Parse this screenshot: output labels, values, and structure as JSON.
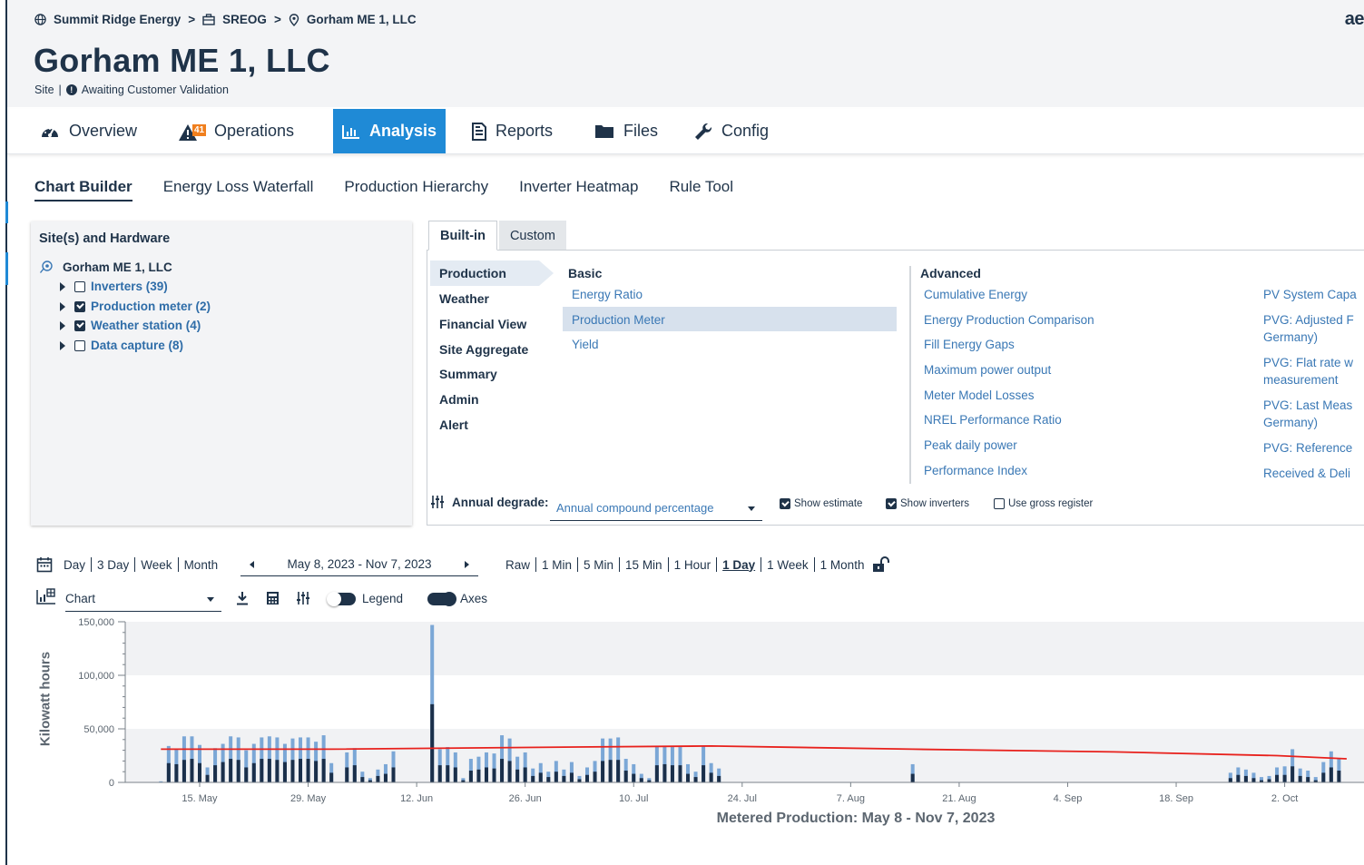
{
  "breadcrumb": {
    "items": [
      {
        "label": "Summit Ridge Energy",
        "icon": "globe-icon"
      },
      {
        "label": "SREOG",
        "icon": "briefcase-icon"
      },
      {
        "label": "Gorham ME 1, LLC",
        "icon": "location-pin-icon"
      }
    ],
    "separator": ">"
  },
  "brand": "ae",
  "site": {
    "title": "Gorham ME 1, LLC",
    "type": "Site",
    "status": "Awaiting Customer Validation"
  },
  "nav": {
    "tabs": [
      {
        "label": "Overview",
        "icon": "gauge-icon"
      },
      {
        "label": "Operations",
        "icon": "alert-triangle-icon",
        "badge": "41"
      },
      {
        "label": "Analysis",
        "icon": "chart-icon",
        "active": true
      },
      {
        "label": "Reports",
        "icon": "report-icon"
      },
      {
        "label": "Files",
        "icon": "folder-icon"
      },
      {
        "label": "Config",
        "icon": "wrench-icon"
      }
    ]
  },
  "subtabs": [
    "Chart Builder",
    "Energy Loss Waterfall",
    "Production Hierarchy",
    "Inverter Heatmap",
    "Rule Tool"
  ],
  "hardware": {
    "heading": "Site(s) and Hardware",
    "root": "Gorham ME 1, LLC",
    "items": [
      {
        "label": "Inverters (39)",
        "checked": false
      },
      {
        "label": "Production meter (2)",
        "checked": true
      },
      {
        "label": "Weather station (4)",
        "checked": true
      },
      {
        "label": "Data capture (8)",
        "checked": false
      }
    ]
  },
  "builder": {
    "tabs": [
      "Built-in",
      "Custom"
    ],
    "categories": [
      "Production",
      "Weather",
      "Financial View",
      "Site Aggregate",
      "Summary",
      "Admin",
      "Alert"
    ],
    "basic_heading": "Basic",
    "basic": [
      "Energy Ratio",
      "Production Meter",
      "Yield"
    ],
    "advanced_heading": "Advanced",
    "advanced": [
      "Cumulative Energy",
      "Energy Production Comparison",
      "Fill Energy Gaps",
      "Maximum power output",
      "Meter Model Losses",
      "NREL Performance Ratio",
      "Peak daily power",
      "Performance Index"
    ],
    "advanced2": [
      "PV System Capa",
      "PVG: Adjusted F",
      "Germany)",
      "PVG: Flat rate w",
      "measurement",
      "PVG: Last Meas",
      "Germany)",
      "PVG: Reference",
      "Received & Deli"
    ],
    "degrade_label": "Annual degrade:",
    "degrade_value": "Annual compound percentage",
    "show_estimate": "Show estimate",
    "show_inverters": "Show inverters",
    "use_gross": "Use gross register"
  },
  "toolbar": {
    "ranges": [
      "Day",
      "3 Day",
      "Week",
      "Month"
    ],
    "date_range": "May 8, 2023 - Nov 7, 2023",
    "resolutions": [
      "Raw",
      "1 Min",
      "5 Min",
      "15 Min",
      "1 Hour",
      "1 Day",
      "1 Week",
      "1 Month"
    ],
    "active_resolution": "1 Day",
    "chart_type": "Chart",
    "legend_label": "Legend",
    "legend_on": false,
    "axes_label": "Axes",
    "axes_on": true
  },
  "colors": {
    "accent": "#1f8ad6",
    "navy": "#1f3349",
    "badge": "#f07f1e",
    "bar_light": "#7ba7d6",
    "bar_dark": "#1a2f4a",
    "estimate_line": "#e8211c"
  },
  "chart_data": {
    "type": "bar",
    "title": "Metered Production: May 8 - Nov 7, 2023",
    "ylabel": "Kilowatt hours",
    "yticks": [
      "0",
      "50,000",
      "100,000",
      "150,000"
    ],
    "ylim": [
      0,
      150000
    ],
    "xticks": [
      "15. May",
      "29. May",
      "12. Jun",
      "26. Jun",
      "10. Jul",
      "24. Jul",
      "7. Aug",
      "21. Aug",
      "4. Sep",
      "18. Sep",
      "2. Oct"
    ],
    "series": [
      {
        "name": "meter-light",
        "color": "#7ba7d6"
      },
      {
        "name": "meter-dark",
        "color": "#1a2f4a"
      },
      {
        "name": "estimate",
        "color": "#e8211c"
      }
    ],
    "bars": [
      {
        "date": "2023-05-10",
        "total": 1000,
        "dark": 400
      },
      {
        "date": "2023-05-11",
        "total": 34000,
        "dark": 18000
      },
      {
        "date": "2023-05-12",
        "total": 31000,
        "dark": 17000
      },
      {
        "date": "2023-05-13",
        "total": 43000,
        "dark": 21000
      },
      {
        "date": "2023-05-14",
        "total": 43000,
        "dark": 22000
      },
      {
        "date": "2023-05-15",
        "total": 35000,
        "dark": 18000
      },
      {
        "date": "2023-05-16",
        "total": 14000,
        "dark": 7000
      },
      {
        "date": "2023-05-17",
        "total": 32000,
        "dark": 16000
      },
      {
        "date": "2023-05-18",
        "total": 36000,
        "dark": 19000
      },
      {
        "date": "2023-05-19",
        "total": 43000,
        "dark": 22000
      },
      {
        "date": "2023-05-20",
        "total": 42000,
        "dark": 21000
      },
      {
        "date": "2023-05-21",
        "total": 30000,
        "dark": 14000
      },
      {
        "date": "2023-05-22",
        "total": 36000,
        "dark": 18000
      },
      {
        "date": "2023-05-23",
        "total": 42000,
        "dark": 22000
      },
      {
        "date": "2023-05-24",
        "total": 43000,
        "dark": 22000
      },
      {
        "date": "2023-05-25",
        "total": 42000,
        "dark": 21000
      },
      {
        "date": "2023-05-26",
        "total": 36000,
        "dark": 19000
      },
      {
        "date": "2023-05-27",
        "total": 41000,
        "dark": 21000
      },
      {
        "date": "2023-05-28",
        "total": 42000,
        "dark": 22000
      },
      {
        "date": "2023-05-29",
        "total": 42000,
        "dark": 22000
      },
      {
        "date": "2023-05-30",
        "total": 38000,
        "dark": 20000
      },
      {
        "date": "2023-05-31",
        "total": 44000,
        "dark": 22000
      },
      {
        "date": "2023-06-01",
        "total": 18000,
        "dark": 9000
      },
      {
        "date": "2023-06-02",
        "total": 0,
        "dark": 0
      },
      {
        "date": "2023-06-03",
        "total": 28000,
        "dark": 14000
      },
      {
        "date": "2023-06-04",
        "total": 32000,
        "dark": 16000
      },
      {
        "date": "2023-06-05",
        "total": 10000,
        "dark": 5000
      },
      {
        "date": "2023-06-06",
        "total": 4000,
        "dark": 2000
      },
      {
        "date": "2023-06-07",
        "total": 12000,
        "dark": 6000
      },
      {
        "date": "2023-06-08",
        "total": 17000,
        "dark": 8000
      },
      {
        "date": "2023-06-09",
        "total": 29000,
        "dark": 14000
      },
      {
        "date": "2023-06-14",
        "total": 147000,
        "dark": 73000
      },
      {
        "date": "2023-06-15",
        "total": 31000,
        "dark": 16000
      },
      {
        "date": "2023-06-16",
        "total": 33000,
        "dark": 16000
      },
      {
        "date": "2023-06-17",
        "total": 28000,
        "dark": 14000
      },
      {
        "date": "2023-06-18",
        "total": 4000,
        "dark": 2000
      },
      {
        "date": "2023-06-19",
        "total": 22000,
        "dark": 11000
      },
      {
        "date": "2023-06-20",
        "total": 24000,
        "dark": 12000
      },
      {
        "date": "2023-06-21",
        "total": 28000,
        "dark": 14000
      },
      {
        "date": "2023-06-22",
        "total": 27000,
        "dark": 13000
      },
      {
        "date": "2023-06-23",
        "total": 44000,
        "dark": 22000
      },
      {
        "date": "2023-06-24",
        "total": 41000,
        "dark": 20000
      },
      {
        "date": "2023-06-25",
        "total": 24000,
        "dark": 12000
      },
      {
        "date": "2023-06-26",
        "total": 28000,
        "dark": 14000
      },
      {
        "date": "2023-06-27",
        "total": 13000,
        "dark": 6000
      },
      {
        "date": "2023-06-28",
        "total": 18000,
        "dark": 9000
      },
      {
        "date": "2023-06-29",
        "total": 10000,
        "dark": 5000
      },
      {
        "date": "2023-06-30",
        "total": 20000,
        "dark": 10000
      },
      {
        "date": "2023-07-01",
        "total": 12000,
        "dark": 6000
      },
      {
        "date": "2023-07-02",
        "total": 19000,
        "dark": 9000
      },
      {
        "date": "2023-07-03",
        "total": 6000,
        "dark": 3000
      },
      {
        "date": "2023-07-04",
        "total": 14000,
        "dark": 7000
      },
      {
        "date": "2023-07-05",
        "total": 20000,
        "dark": 10000
      },
      {
        "date": "2023-07-06",
        "total": 41000,
        "dark": 20000
      },
      {
        "date": "2023-07-07",
        "total": 41000,
        "dark": 21000
      },
      {
        "date": "2023-07-08",
        "total": 42000,
        "dark": 21000
      },
      {
        "date": "2023-07-09",
        "total": 22000,
        "dark": 11000
      },
      {
        "date": "2023-07-10",
        "total": 17000,
        "dark": 8000
      },
      {
        "date": "2023-07-11",
        "total": 8000,
        "dark": 4000
      },
      {
        "date": "2023-07-12",
        "total": 4000,
        "dark": 2000
      },
      {
        "date": "2023-07-13",
        "total": 34000,
        "dark": 16000
      },
      {
        "date": "2023-07-14",
        "total": 34000,
        "dark": 17000
      },
      {
        "date": "2023-07-15",
        "total": 33000,
        "dark": 16000
      },
      {
        "date": "2023-07-16",
        "total": 33000,
        "dark": 16000
      },
      {
        "date": "2023-07-17",
        "total": 17000,
        "dark": 8000
      },
      {
        "date": "2023-07-18",
        "total": 10000,
        "dark": 5000
      },
      {
        "date": "2023-07-19",
        "total": 34000,
        "dark": 16000
      },
      {
        "date": "2023-07-20",
        "total": 18000,
        "dark": 9000
      },
      {
        "date": "2023-07-21",
        "total": 13000,
        "dark": 6000
      },
      {
        "date": "2023-08-15",
        "total": 17000,
        "dark": 8000
      },
      {
        "date": "2023-09-25",
        "total": 9000,
        "dark": 4000
      },
      {
        "date": "2023-09-26",
        "total": 14000,
        "dark": 7000
      },
      {
        "date": "2023-09-27",
        "total": 12000,
        "dark": 6000
      },
      {
        "date": "2023-09-28",
        "total": 9000,
        "dark": 4000
      },
      {
        "date": "2023-09-29",
        "total": 5000,
        "dark": 2000
      },
      {
        "date": "2023-09-30",
        "total": 6000,
        "dark": 3000
      },
      {
        "date": "2023-10-01",
        "total": 14000,
        "dark": 7000
      },
      {
        "date": "2023-10-02",
        "total": 15000,
        "dark": 7000
      },
      {
        "date": "2023-10-03",
        "total": 31000,
        "dark": 15000
      },
      {
        "date": "2023-10-04",
        "total": 13000,
        "dark": 6000
      },
      {
        "date": "2023-10-05",
        "total": 11000,
        "dark": 5000
      },
      {
        "date": "2023-10-06",
        "total": 5000,
        "dark": 2000
      },
      {
        "date": "2023-10-07",
        "total": 19000,
        "dark": 9000
      },
      {
        "date": "2023-10-08",
        "total": 29000,
        "dark": 14000
      },
      {
        "date": "2023-10-09",
        "total": 22000,
        "dark": 11000
      }
    ],
    "estimate": [
      {
        "date": "2023-05-10",
        "value": 31000
      },
      {
        "date": "2023-06-01",
        "value": 31000
      },
      {
        "date": "2023-07-01",
        "value": 33000
      },
      {
        "date": "2023-07-20",
        "value": 34000
      },
      {
        "date": "2023-08-15",
        "value": 31000
      },
      {
        "date": "2023-09-10",
        "value": 28500
      },
      {
        "date": "2023-10-01",
        "value": 25000
      },
      {
        "date": "2023-10-10",
        "value": 22000
      }
    ]
  }
}
